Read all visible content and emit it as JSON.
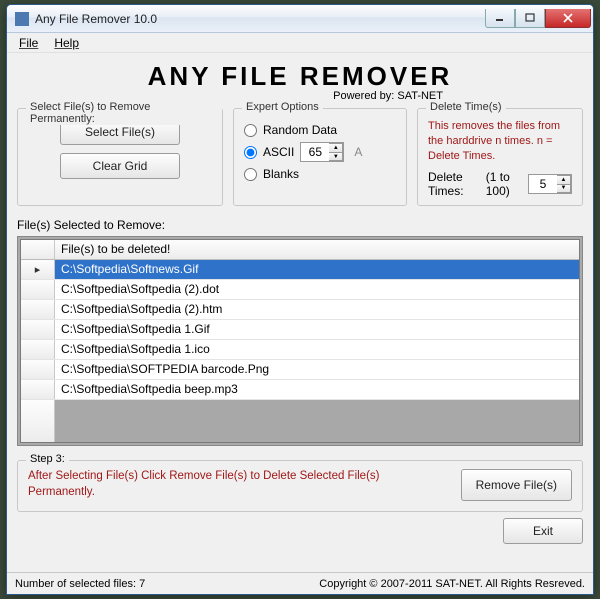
{
  "window": {
    "title": "Any File Remover 10.0"
  },
  "menu": {
    "file": "File",
    "help": "Help"
  },
  "brand": {
    "title": "ANY FILE REMOVER",
    "powered": "Powered by: SAT-NET"
  },
  "select_group": {
    "legend": "Select File(s) to Remove Permanently:",
    "select_btn": "Select File(s)",
    "clear_btn": "Clear Grid"
  },
  "expert": {
    "legend": "Expert Options",
    "random": "Random Data",
    "ascii": "ASCII",
    "ascii_value": "65",
    "ascii_suffix": "A",
    "blanks": "Blanks"
  },
  "delete": {
    "legend": "Delete Time(s)",
    "desc": "This removes the files from the harddrive n times. n = Delete Times.",
    "label": "Delete Times:",
    "range": "(1 to 100)",
    "value": "5"
  },
  "grid": {
    "label": "File(s) Selected to Remove:",
    "header": "File(s) to be deleted!",
    "rows": [
      "C:\\Softpedia\\Softnews.Gif",
      "C:\\Softpedia\\Softpedia (2).dot",
      "C:\\Softpedia\\Softpedia (2).htm",
      "C:\\Softpedia\\Softpedia 1.Gif",
      "C:\\Softpedia\\Softpedia 1.ico",
      "C:\\Softpedia\\SOFTPEDIA barcode.Png",
      "C:\\Softpedia\\Softpedia beep.mp3"
    ],
    "selected_index": 0
  },
  "step3": {
    "legend": "Step 3:",
    "msg": "After Selecting File(s) Click Remove File(s) to Delete Selected File(s) Permanently.",
    "remove_btn": "Remove File(s)"
  },
  "exit_btn": "Exit",
  "status": {
    "left": "Number of selected files:  7",
    "right": "Copyright © 2007-2011 SAT-NET. All Rights Resreved."
  }
}
